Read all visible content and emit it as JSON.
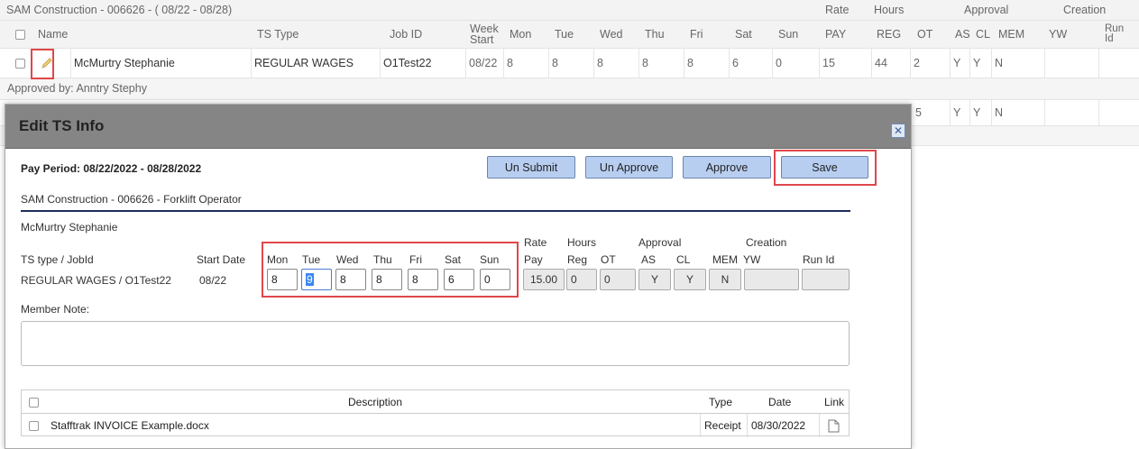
{
  "background": {
    "group_title": "SAM Construction - 006626 - ( 08/22 - 08/28)",
    "group_headers": {
      "rate": "Rate",
      "hours": "Hours",
      "approval": "Approval",
      "creation": "Creation"
    },
    "columns": {
      "name": "Name",
      "ts_type": "TS Type",
      "job_id": "Job ID",
      "week_start": "Week Start",
      "mon": "Mon",
      "tue": "Tue",
      "wed": "Wed",
      "thu": "Thu",
      "fri": "Fri",
      "sat": "Sat",
      "sun": "Sun",
      "pay": "PAY",
      "reg": "REG",
      "ot": "OT",
      "as": "AS",
      "cl": "CL",
      "mem": "MEM",
      "yw": "YW",
      "run_id": "Run Id"
    },
    "row": {
      "name": "McMurtry Stephanie",
      "ts_type": "REGULAR WAGES",
      "job_id": "O1Test22",
      "week_start": "08/22",
      "mon": "8",
      "tue": "8",
      "wed": "8",
      "thu": "8",
      "fri": "8",
      "sat": "6",
      "sun": "0",
      "pay": "15",
      "reg": "44",
      "ot": "2",
      "as": "Y",
      "cl": "Y",
      "mem": "N"
    },
    "approved_by": "Approved by: Anntry Stephy",
    "row2": {
      "partial_ot": "5",
      "as": "Y",
      "cl": "Y",
      "mem": "N"
    }
  },
  "modal": {
    "title": "Edit TS Info",
    "pay_period": "Pay Period: 08/22/2022 - 08/28/2022",
    "buttons": {
      "unsubmit": "Un Submit",
      "unapprove": "Un Approve",
      "approve": "Approve",
      "save": "Save"
    },
    "subtitle": "SAM Construction - 006626 - Forklift Operator",
    "member": "McMurtry Stephanie",
    "group_headers": {
      "rate": "Rate",
      "hours": "Hours",
      "approval": "Approval",
      "creation": "Creation"
    },
    "labels": {
      "ts_type_jobid": "TS type / JobId",
      "start_date": "Start Date",
      "mon": "Mon",
      "tue": "Tue",
      "wed": "Wed",
      "thu": "Thu",
      "fri": "Fri",
      "sat": "Sat",
      "sun": "Sun",
      "pay": "Pay",
      "reg": "Reg",
      "ot": "OT",
      "as": "AS",
      "cl": "CL",
      "mem": "MEM",
      "yw": "YW",
      "run_id": "Run Id"
    },
    "values": {
      "ts_type_jobid": "REGULAR WAGES / O1Test22",
      "start_date": "08/22",
      "mon": "8",
      "tue": "9",
      "wed": "8",
      "thu": "8",
      "fri": "8",
      "sat": "6",
      "sun": "0",
      "pay": "15.00",
      "reg": "0",
      "ot": "0",
      "as": "Y",
      "cl": "Y",
      "mem": "N",
      "yw": "",
      "run_id": ""
    },
    "member_note_label": "Member Note:",
    "member_note_value": "",
    "attachments": {
      "headers": {
        "description": "Description",
        "type": "Type",
        "date": "Date",
        "link": "Link"
      },
      "rows": [
        {
          "description": "Stafftrak INVOICE Example.docx",
          "type": "Receipt",
          "date": "08/30/2022"
        }
      ]
    }
  },
  "colors": {
    "accent_red": "#e0464a",
    "button_blue": "#b8cef0",
    "header_gray": "#858585",
    "divider_navy": "#1f2d5a"
  }
}
